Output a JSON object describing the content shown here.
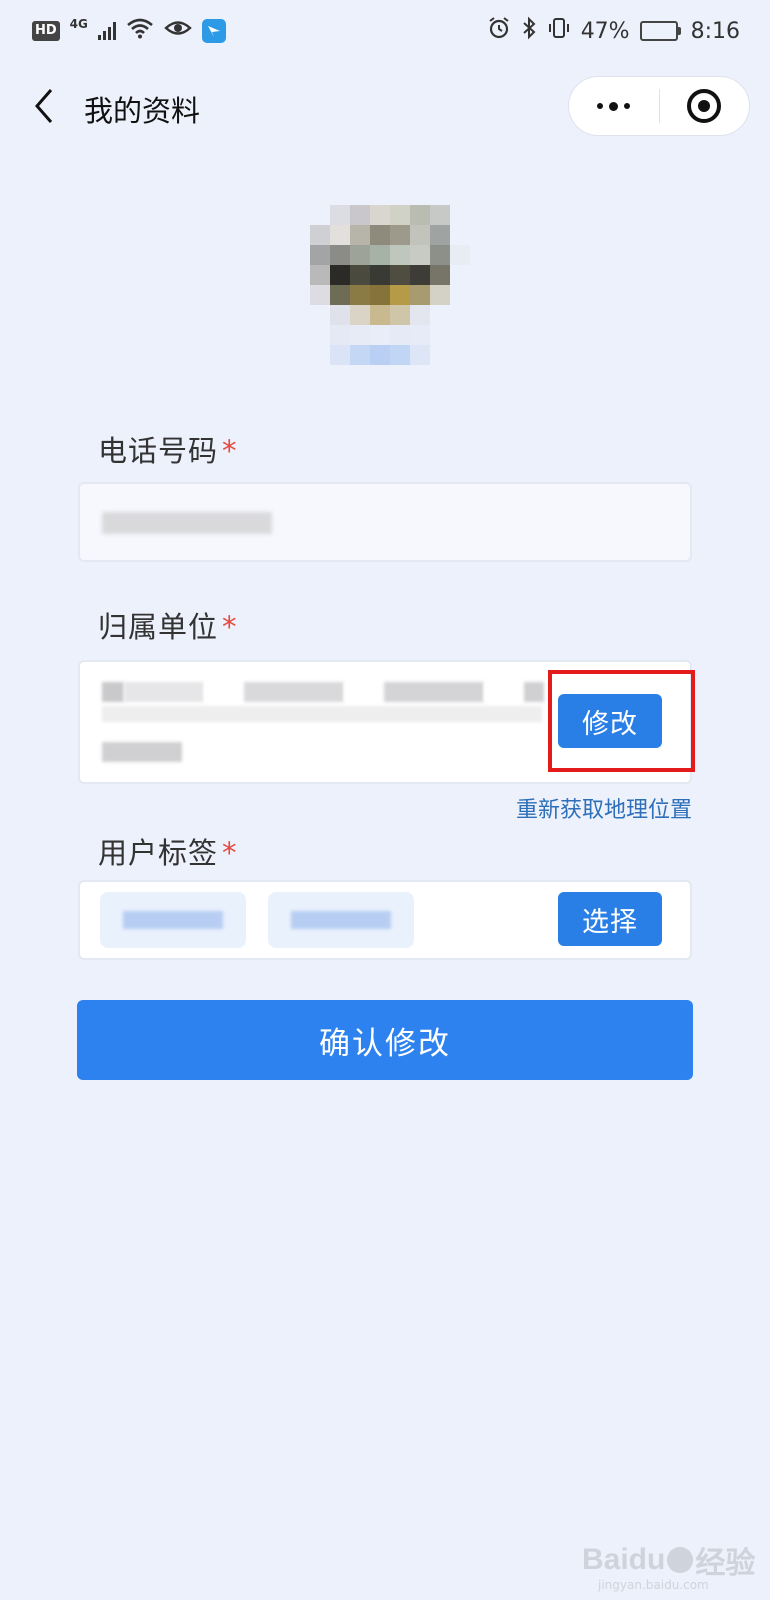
{
  "status_bar": {
    "hd": "HD",
    "network": "4G",
    "battery_percent": "47%",
    "battery_level": 0.47,
    "time": "8:16"
  },
  "nav": {
    "title": "我的资料",
    "back_icon": "chevron-left-icon",
    "more_icon": "more-dots-icon",
    "close_icon": "target-circle-icon"
  },
  "form": {
    "phone": {
      "label": "电话号码",
      "required_mark": "*"
    },
    "unit": {
      "label": "归属单位",
      "required_mark": "*",
      "modify_label": "修改",
      "relocate_label": "重新获取地理位置"
    },
    "tags": {
      "label": "用户标签",
      "required_mark": "*",
      "select_label": "选择"
    },
    "confirm_label": "确认修改"
  },
  "watermark": {
    "brand": "Baidu",
    "suffix": "经验",
    "url": "jingyan.baidu.com"
  },
  "colors": {
    "background": "#edf1fb",
    "primary": "#2d82f0",
    "required": "#e5483f",
    "link": "#2d6fb8",
    "highlight": "#e31b1b"
  }
}
